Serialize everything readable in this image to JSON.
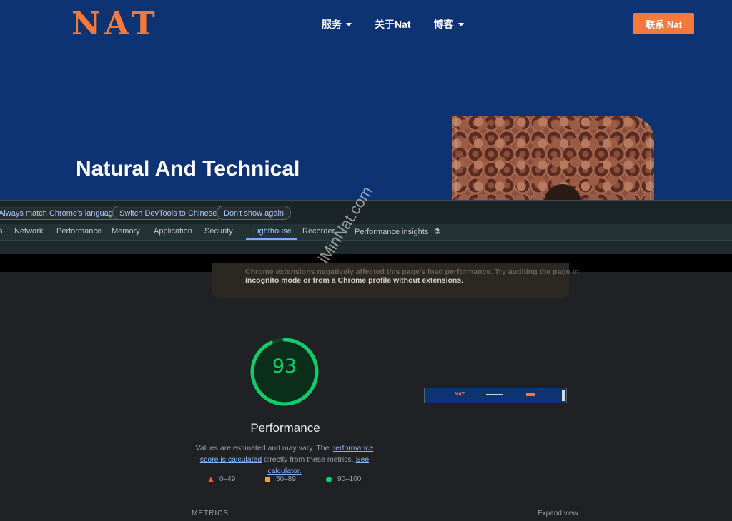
{
  "site": {
    "logo": "NAT",
    "nav": [
      "服务",
      "关于Nat",
      "博客"
    ],
    "contact_button": "联系 Nat",
    "hero_title": "Natural And Technical"
  },
  "devtools": {
    "infobar": {
      "always_match": "Always match Chrome's language",
      "switch_chinese": "Switch DevTools to Chinese",
      "dont_show": "Don't show again"
    },
    "tabs": [
      "s",
      "Network",
      "Performance",
      "Memory",
      "Application",
      "Security",
      "Lighthouse",
      "Recorder",
      "Performance insights"
    ],
    "active_tab": "Lighthouse"
  },
  "lighthouse": {
    "warning_line1": "Chrome extensions negatively affected this page's load performance. Try auditing the page in",
    "warning_line2": "incognito mode or from a Chrome profile without extensions.",
    "score": "93",
    "score_fraction": 0.93,
    "category": "Performance",
    "desc_part1": "Values are estimated and may vary. The ",
    "desc_link1": "performance score is calculated",
    "desc_part2": " directly from these metrics. ",
    "desc_link2": "See calculator.",
    "legend": {
      "fail": "0–49",
      "average": "50–89",
      "pass": "90–100"
    },
    "metrics_label": "METRICS",
    "expand_view": "Expand view",
    "thumbnail_logo": "NAT"
  },
  "watermark": "iMinNat.com",
  "colors": {
    "site_bg": "#0d3372",
    "accent": "#f5793b",
    "pass": "#0cce6b",
    "average": "#ffa400",
    "fail": "#ff4e42"
  }
}
